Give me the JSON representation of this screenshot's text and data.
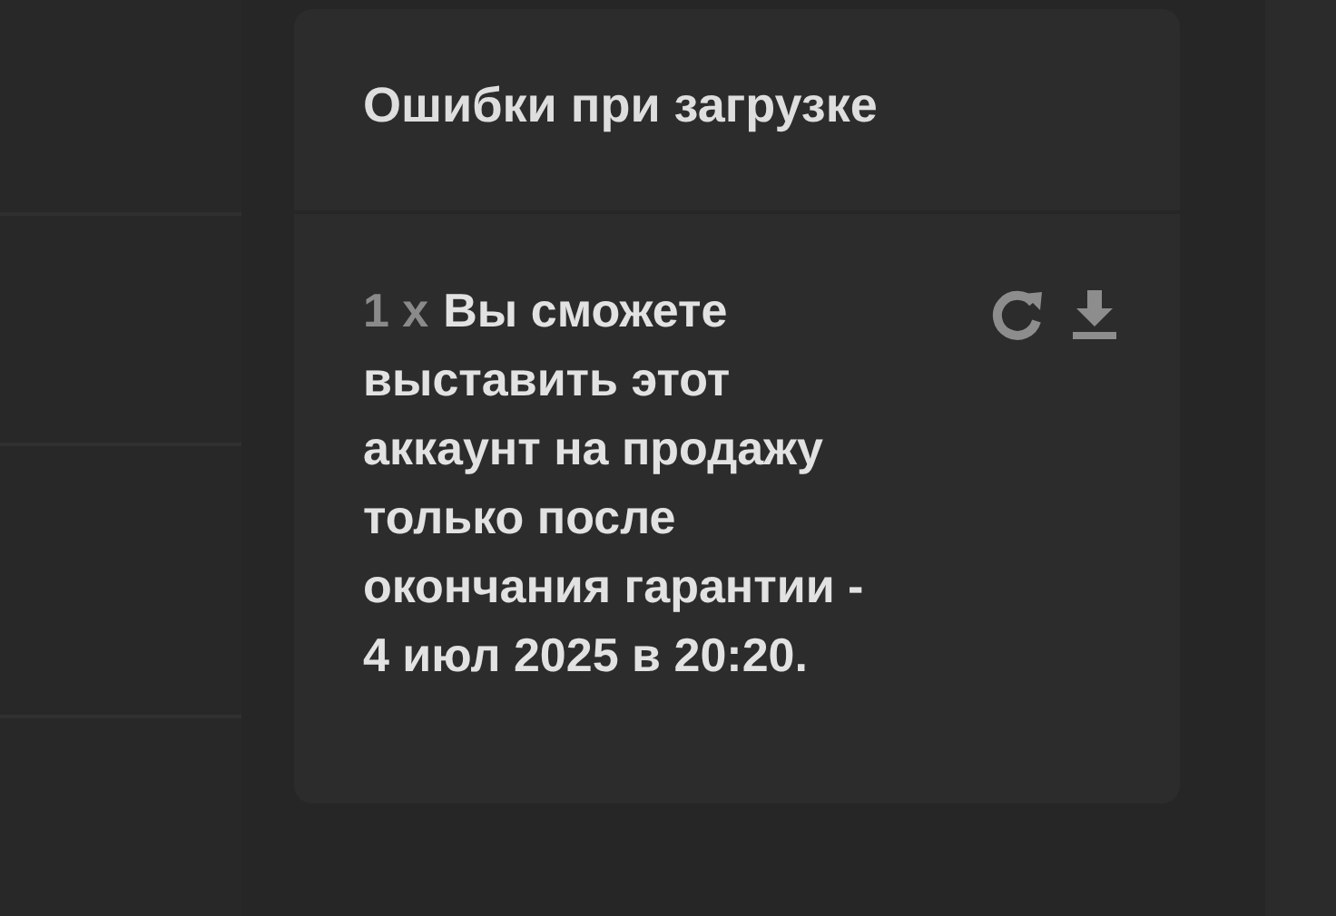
{
  "panel": {
    "title": "Ошибки при загрузке"
  },
  "errors": [
    {
      "count": "1 x",
      "message": "Вы сможете выставить этот аккаунт на продажу только после окончания гарантии - 4 июл 2025 в 20:20."
    }
  ]
}
